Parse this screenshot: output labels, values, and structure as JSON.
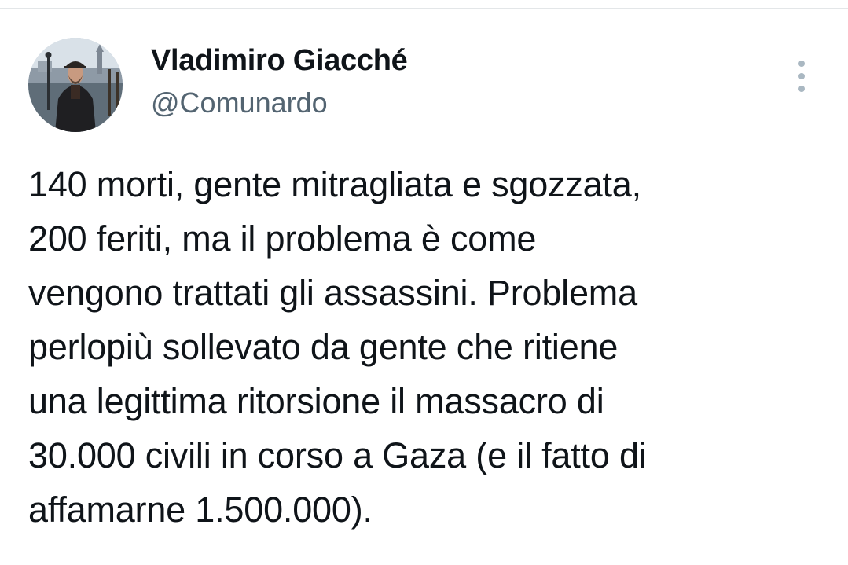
{
  "author": {
    "display_name": "Vladimiro Giacché",
    "handle": "@Comunardo",
    "avatar_icon": "user-avatar-photo"
  },
  "menu": {
    "icon": "more-vertical-icon"
  },
  "tweet": {
    "text": "140 morti, gente mitragliata e sgozzata,\n200 feriti, ma il problema è come\nvengono trattati gli assassini. Problema\nperlopiù sollevato da gente che ritiene\nuna legittima ritorsione il massacro di\n30.000 civili in corso a Gaza (e il fatto di\naffamarne 1.500.000)."
  },
  "colors": {
    "text_primary": "#0f1419",
    "text_secondary": "#536471",
    "menu_dots": "#aab8c2",
    "background": "#ffffff"
  }
}
